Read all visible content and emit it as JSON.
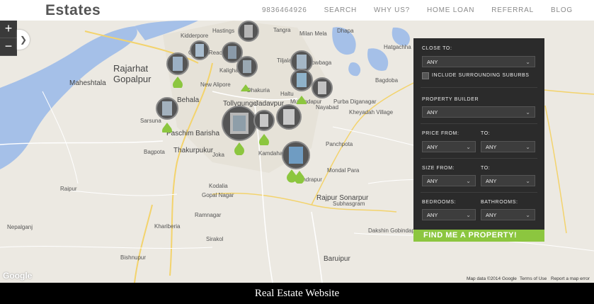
{
  "brand": {
    "logo_text": "Estates"
  },
  "nav": {
    "phone": "9836464926",
    "items": [
      "SEARCH",
      "WHY US?",
      "HOME LOAN",
      "REFERRAL",
      "BLOG"
    ]
  },
  "map": {
    "zoom_in": "+",
    "zoom_out": "−",
    "places_big": [
      "Rajarhat",
      "Gopalpur"
    ],
    "places": [
      "Maheshtala",
      "Garden Reach",
      "Behala",
      "New Alipore",
      "Kalighat",
      "Dhakuria",
      "Tollygunge",
      "Jadavpur",
      "Haltu",
      "Mukundapur",
      "Nayabad",
      "Sarsuna",
      "Paschim Barisha",
      "Thakurpukur",
      "Bagpota",
      "Kamdahari",
      "Narendrapur",
      "Panchpota",
      "Mondal Para",
      "Rajpur Sonarpur",
      "Subhasgram",
      "Baruipur",
      "Kodalia",
      "Bishnupur",
      "Khariberia",
      "Sirakol",
      "Kidderpore",
      "Hastings",
      "Tangra",
      "Tiljala",
      "Chowbaga",
      "Milan Mela",
      "Dhapa",
      "Hatgachha",
      "Bagdoba",
      "Purba Diganagar",
      "Kheyadah Village",
      "Raipur",
      "Nepalganj",
      "Joka",
      "Dakshin Gobindapur",
      "Gopal Nagar",
      "Ramnagar"
    ],
    "google_logo": "Google",
    "attribution": [
      "Map data ©2014 Google",
      "Terms of Use",
      "Report a map error"
    ]
  },
  "search_panel": {
    "close_to_label": "CLOSE TO:",
    "close_to_value": "ANY",
    "surrounding_label": "INCLUDE SURROUNDING SUBURBS",
    "builder_label": "PROPERTY BUILDER",
    "builder_value": "ANY",
    "price_from_label": "PRICE FROM:",
    "price_from_value": "ANY",
    "price_to_label": "TO:",
    "price_to_value": "ANY",
    "size_from_label": "SIZE FROM:",
    "size_from_value": "ANY",
    "size_to_label": "TO:",
    "size_to_value": "ANY",
    "bedrooms_label": "BEDROOMS:",
    "bedrooms_value": "ANY",
    "bathrooms_label": "BATHROOMS:",
    "bathrooms_value": "ANY",
    "submit_label": "FIND ME A PROPERTY!"
  },
  "caption": "Real Estate Website",
  "colors": {
    "accent": "#8cc63f",
    "panel": "#2b2b2b",
    "river": "#a5c0e8",
    "road": "#f3d36c"
  }
}
